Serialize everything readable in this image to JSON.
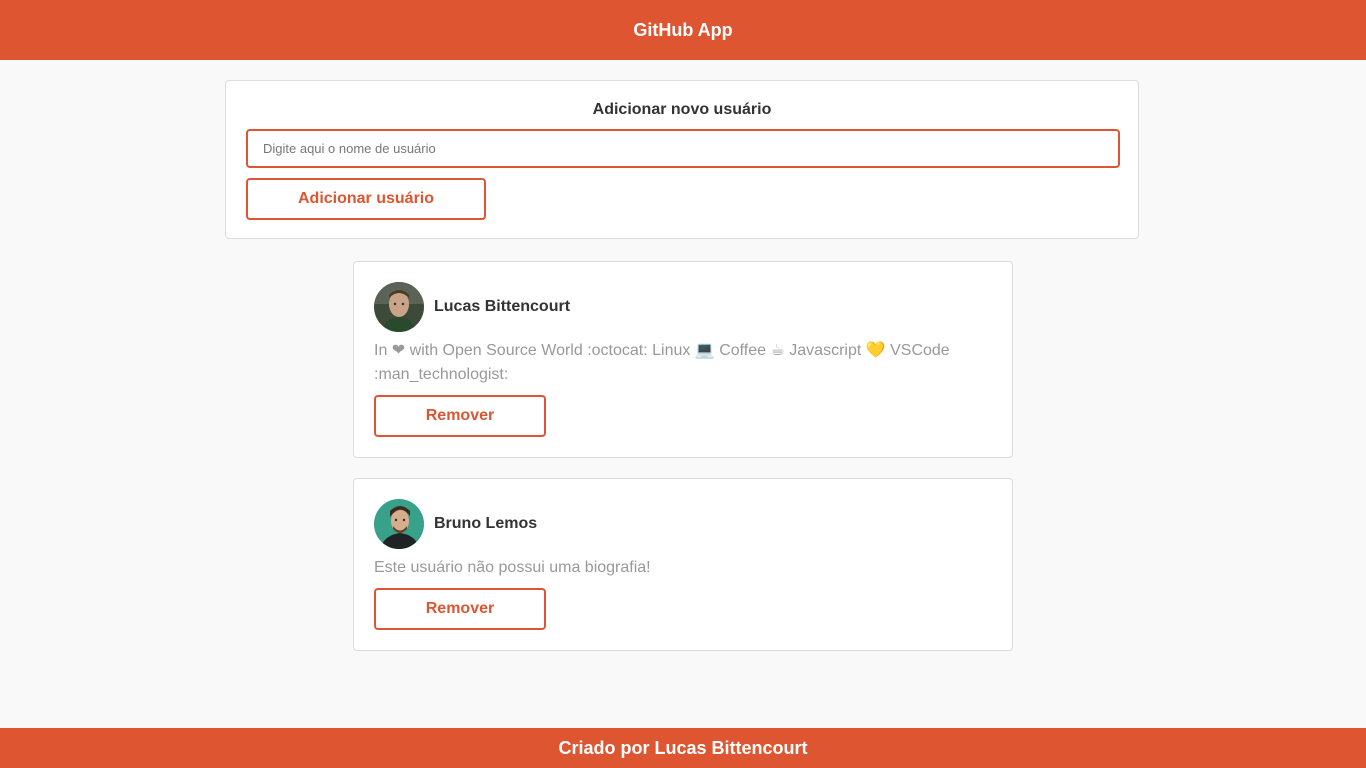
{
  "app": {
    "title": "GitHub App",
    "accent_color": "#dd5531"
  },
  "add_user": {
    "heading": "Adicionar novo usuário",
    "input_value": "",
    "input_placeholder": "Digite aqui o nome de usuário",
    "button_label": "Adicionar usuário"
  },
  "users": [
    {
      "name": "Lucas Bittencourt",
      "bio": "In ❤ with Open Source World :octocat: Linux 💻 Coffee ☕ Javascript 💛 VSCode :man_technologist:",
      "avatar_icon": "user-avatar-photo",
      "remove_label": "Remover"
    },
    {
      "name": "Bruno Lemos",
      "bio": "Este usuário não possui uma biografia!",
      "avatar_icon": "user-avatar-photo",
      "remove_label": "Remover"
    }
  ],
  "footer": {
    "text": "Criado por Lucas Bittencourt"
  }
}
